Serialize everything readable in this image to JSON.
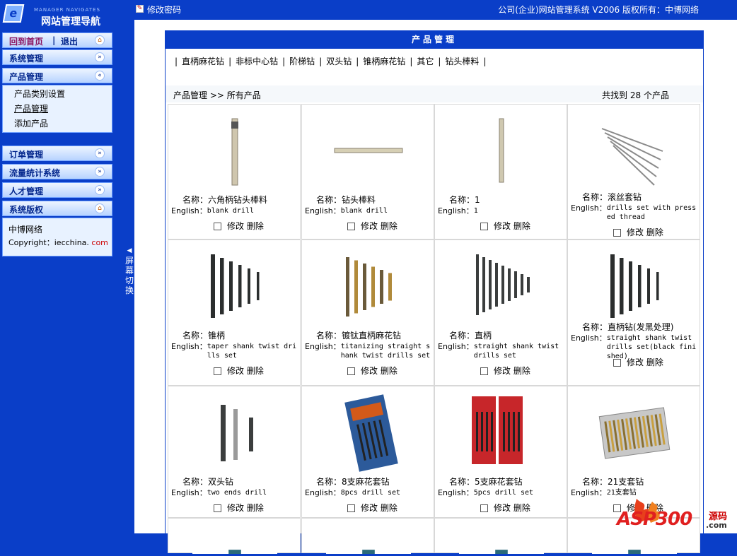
{
  "sidebar": {
    "logo_small": "MANAGER NAVIGATES",
    "logo_title": "网站管理导航",
    "home": "回到首页",
    "sep": "|",
    "logout": "退出",
    "menus": {
      "system": "系统管理",
      "product": "产品管理",
      "orders": "订单管理",
      "traffic": "流量统计系统",
      "talent": "人才管理",
      "copyright": "系统版权"
    },
    "product_items": [
      "产品类别设置",
      "产品管理",
      "添加产品"
    ],
    "copyright_lines": [
      "中博网络",
      "Copyright：iecchina.",
      "com"
    ],
    "toggle": [
      "屏",
      "幕",
      "切",
      "换"
    ]
  },
  "topbar": {
    "change_password": "修改密码",
    "copyright": "公司(企业)网站管理系统 V2006 版权所有：中博网络"
  },
  "panel": {
    "title": "产品管理",
    "categories": [
      "直柄麻花钻",
      "非标中心钻",
      "阶梯钻",
      "双头钻",
      "锥柄麻花钻",
      "其它",
      "钻头棒料"
    ],
    "breadcrumb": "产品管理 >> 所有产品",
    "found_prefix": "共找到",
    "found_count": "28",
    "found_suffix": "个产品"
  },
  "labels": {
    "name": "名称：",
    "english": "English：",
    "edit": "修改",
    "delete": "删除"
  },
  "products": [
    {
      "name": "六角柄钻头棒料",
      "english": "blank drill"
    },
    {
      "name": "钻头棒料",
      "english": "blank drill"
    },
    {
      "name": "1",
      "english": "1"
    },
    {
      "name": "滚丝套钻",
      "english": "drills set with pressed thread"
    },
    {
      "name": "锥柄",
      "english": "taper shank twist drills set"
    },
    {
      "name": "镀钛直柄麻花钻",
      "english": "titanizing straight shank twist drills set"
    },
    {
      "name": "直柄",
      "english": "straight shank twist drills set"
    },
    {
      "name": "直柄钻(发黑处理)",
      "english": "straight shank twist drills set(black finished)"
    },
    {
      "name": "双头钻",
      "english": "two ends drill"
    },
    {
      "name": "8支麻花套钻",
      "english": "8pcs drill set"
    },
    {
      "name": "5支麻花套钻",
      "english": "5pcs drill set"
    },
    {
      "name": "21支套钻",
      "english": "21支套钻"
    }
  ],
  "watermark": {
    "text": "ASP300",
    "sub": "源码",
    "dom": ".com"
  },
  "colors": {
    "nav_blue": "#0a3ec8",
    "menu_text": "#04278d",
    "home_text": "#8a0f5c"
  }
}
